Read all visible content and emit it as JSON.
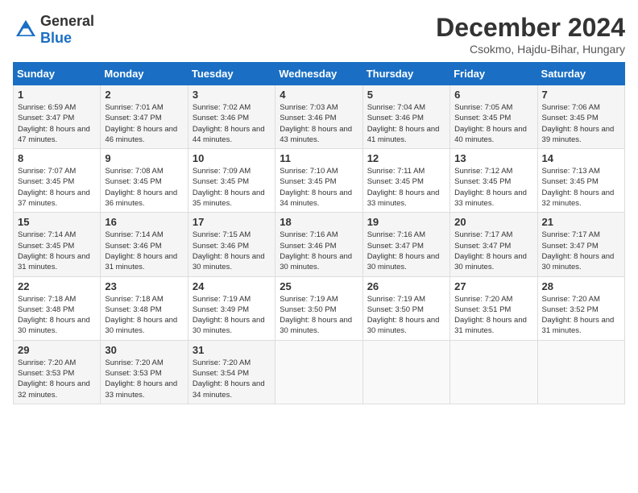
{
  "header": {
    "logo_general": "General",
    "logo_blue": "Blue",
    "month": "December 2024",
    "location": "Csokmo, Hajdu-Bihar, Hungary"
  },
  "days_of_week": [
    "Sunday",
    "Monday",
    "Tuesday",
    "Wednesday",
    "Thursday",
    "Friday",
    "Saturday"
  ],
  "weeks": [
    [
      {
        "day": "1",
        "sunrise": "Sunrise: 6:59 AM",
        "sunset": "Sunset: 3:47 PM",
        "daylight": "Daylight: 8 hours and 47 minutes."
      },
      {
        "day": "2",
        "sunrise": "Sunrise: 7:01 AM",
        "sunset": "Sunset: 3:47 PM",
        "daylight": "Daylight: 8 hours and 46 minutes."
      },
      {
        "day": "3",
        "sunrise": "Sunrise: 7:02 AM",
        "sunset": "Sunset: 3:46 PM",
        "daylight": "Daylight: 8 hours and 44 minutes."
      },
      {
        "day": "4",
        "sunrise": "Sunrise: 7:03 AM",
        "sunset": "Sunset: 3:46 PM",
        "daylight": "Daylight: 8 hours and 43 minutes."
      },
      {
        "day": "5",
        "sunrise": "Sunrise: 7:04 AM",
        "sunset": "Sunset: 3:46 PM",
        "daylight": "Daylight: 8 hours and 41 minutes."
      },
      {
        "day": "6",
        "sunrise": "Sunrise: 7:05 AM",
        "sunset": "Sunset: 3:45 PM",
        "daylight": "Daylight: 8 hours and 40 minutes."
      },
      {
        "day": "7",
        "sunrise": "Sunrise: 7:06 AM",
        "sunset": "Sunset: 3:45 PM",
        "daylight": "Daylight: 8 hours and 39 minutes."
      }
    ],
    [
      {
        "day": "8",
        "sunrise": "Sunrise: 7:07 AM",
        "sunset": "Sunset: 3:45 PM",
        "daylight": "Daylight: 8 hours and 37 minutes."
      },
      {
        "day": "9",
        "sunrise": "Sunrise: 7:08 AM",
        "sunset": "Sunset: 3:45 PM",
        "daylight": "Daylight: 8 hours and 36 minutes."
      },
      {
        "day": "10",
        "sunrise": "Sunrise: 7:09 AM",
        "sunset": "Sunset: 3:45 PM",
        "daylight": "Daylight: 8 hours and 35 minutes."
      },
      {
        "day": "11",
        "sunrise": "Sunrise: 7:10 AM",
        "sunset": "Sunset: 3:45 PM",
        "daylight": "Daylight: 8 hours and 34 minutes."
      },
      {
        "day": "12",
        "sunrise": "Sunrise: 7:11 AM",
        "sunset": "Sunset: 3:45 PM",
        "daylight": "Daylight: 8 hours and 33 minutes."
      },
      {
        "day": "13",
        "sunrise": "Sunrise: 7:12 AM",
        "sunset": "Sunset: 3:45 PM",
        "daylight": "Daylight: 8 hours and 33 minutes."
      },
      {
        "day": "14",
        "sunrise": "Sunrise: 7:13 AM",
        "sunset": "Sunset: 3:45 PM",
        "daylight": "Daylight: 8 hours and 32 minutes."
      }
    ],
    [
      {
        "day": "15",
        "sunrise": "Sunrise: 7:14 AM",
        "sunset": "Sunset: 3:45 PM",
        "daylight": "Daylight: 8 hours and 31 minutes."
      },
      {
        "day": "16",
        "sunrise": "Sunrise: 7:14 AM",
        "sunset": "Sunset: 3:46 PM",
        "daylight": "Daylight: 8 hours and 31 minutes."
      },
      {
        "day": "17",
        "sunrise": "Sunrise: 7:15 AM",
        "sunset": "Sunset: 3:46 PM",
        "daylight": "Daylight: 8 hours and 30 minutes."
      },
      {
        "day": "18",
        "sunrise": "Sunrise: 7:16 AM",
        "sunset": "Sunset: 3:46 PM",
        "daylight": "Daylight: 8 hours and 30 minutes."
      },
      {
        "day": "19",
        "sunrise": "Sunrise: 7:16 AM",
        "sunset": "Sunset: 3:47 PM",
        "daylight": "Daylight: 8 hours and 30 minutes."
      },
      {
        "day": "20",
        "sunrise": "Sunrise: 7:17 AM",
        "sunset": "Sunset: 3:47 PM",
        "daylight": "Daylight: 8 hours and 30 minutes."
      },
      {
        "day": "21",
        "sunrise": "Sunrise: 7:17 AM",
        "sunset": "Sunset: 3:47 PM",
        "daylight": "Daylight: 8 hours and 30 minutes."
      }
    ],
    [
      {
        "day": "22",
        "sunrise": "Sunrise: 7:18 AM",
        "sunset": "Sunset: 3:48 PM",
        "daylight": "Daylight: 8 hours and 30 minutes."
      },
      {
        "day": "23",
        "sunrise": "Sunrise: 7:18 AM",
        "sunset": "Sunset: 3:48 PM",
        "daylight": "Daylight: 8 hours and 30 minutes."
      },
      {
        "day": "24",
        "sunrise": "Sunrise: 7:19 AM",
        "sunset": "Sunset: 3:49 PM",
        "daylight": "Daylight: 8 hours and 30 minutes."
      },
      {
        "day": "25",
        "sunrise": "Sunrise: 7:19 AM",
        "sunset": "Sunset: 3:50 PM",
        "daylight": "Daylight: 8 hours and 30 minutes."
      },
      {
        "day": "26",
        "sunrise": "Sunrise: 7:19 AM",
        "sunset": "Sunset: 3:50 PM",
        "daylight": "Daylight: 8 hours and 30 minutes."
      },
      {
        "day": "27",
        "sunrise": "Sunrise: 7:20 AM",
        "sunset": "Sunset: 3:51 PM",
        "daylight": "Daylight: 8 hours and 31 minutes."
      },
      {
        "day": "28",
        "sunrise": "Sunrise: 7:20 AM",
        "sunset": "Sunset: 3:52 PM",
        "daylight": "Daylight: 8 hours and 31 minutes."
      }
    ],
    [
      {
        "day": "29",
        "sunrise": "Sunrise: 7:20 AM",
        "sunset": "Sunset: 3:53 PM",
        "daylight": "Daylight: 8 hours and 32 minutes."
      },
      {
        "day": "30",
        "sunrise": "Sunrise: 7:20 AM",
        "sunset": "Sunset: 3:53 PM",
        "daylight": "Daylight: 8 hours and 33 minutes."
      },
      {
        "day": "31",
        "sunrise": "Sunrise: 7:20 AM",
        "sunset": "Sunset: 3:54 PM",
        "daylight": "Daylight: 8 hours and 34 minutes."
      },
      null,
      null,
      null,
      null
    ]
  ]
}
